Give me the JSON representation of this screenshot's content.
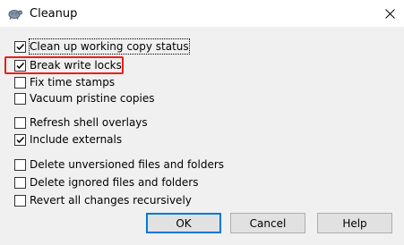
{
  "window": {
    "title": "Cleanup",
    "close_glyph": "✕"
  },
  "options": [
    {
      "label": "Clean up working copy status",
      "checked": true
    },
    {
      "label": "Break write locks",
      "checked": true
    },
    {
      "label": "Fix time stamps",
      "checked": false
    },
    {
      "label": "Vacuum pristine copies",
      "checked": false
    },
    {
      "label": "Refresh shell overlays",
      "checked": false
    },
    {
      "label": "Include externals",
      "checked": true
    },
    {
      "label": "Delete unversioned files and folders",
      "checked": false
    },
    {
      "label": "Delete ignored files and folders",
      "checked": false
    },
    {
      "label": "Revert all changes recursively",
      "checked": false
    }
  ],
  "buttons": {
    "ok": "OK",
    "cancel": "Cancel",
    "help": "Help"
  },
  "colors": {
    "highlight": "#e8201a",
    "default_button_border": "#0078d7",
    "dialog_background": "#f0f0f0"
  }
}
